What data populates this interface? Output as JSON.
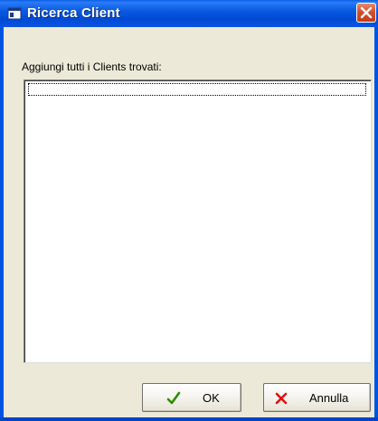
{
  "window": {
    "title": "Ricerca Client"
  },
  "main": {
    "list_label": "Aggiungi tutti i Clients trovati:",
    "items": []
  },
  "buttons": {
    "ok_label": "OK",
    "cancel_label": "Annulla"
  },
  "colors": {
    "titlebar": "#0054e3",
    "dialog_bg": "#ece9d8",
    "close_button": "#d2502e",
    "ok_check": "#2e8b00",
    "cancel_x": "#e01010"
  },
  "icons": {
    "title": "app-window-icon",
    "close": "close-icon",
    "ok": "checkmark-icon",
    "cancel": "cross-icon"
  }
}
